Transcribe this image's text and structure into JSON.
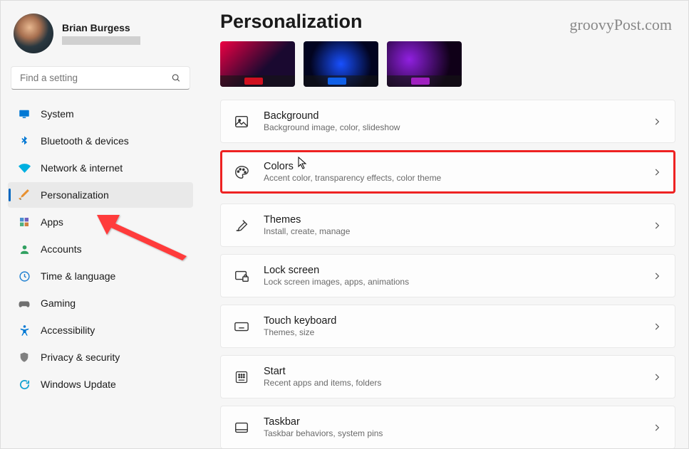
{
  "watermark": "groovyPost.com",
  "profile": {
    "name": "Brian Burgess"
  },
  "search": {
    "placeholder": "Find a setting"
  },
  "sidebar": {
    "items": [
      {
        "label": "System"
      },
      {
        "label": "Bluetooth & devices"
      },
      {
        "label": "Network & internet"
      },
      {
        "label": "Personalization"
      },
      {
        "label": "Apps"
      },
      {
        "label": "Accounts"
      },
      {
        "label": "Time & language"
      },
      {
        "label": "Gaming"
      },
      {
        "label": "Accessibility"
      },
      {
        "label": "Privacy & security"
      },
      {
        "label": "Windows Update"
      }
    ]
  },
  "page": {
    "title": "Personalization"
  },
  "themes": {
    "accents": [
      "#d01020",
      "#1060e8",
      "#a020c0"
    ]
  },
  "cards": [
    {
      "title": "Background",
      "sub": "Background image, color, slideshow"
    },
    {
      "title": "Colors",
      "sub": "Accent color, transparency effects, color theme"
    },
    {
      "title": "Themes",
      "sub": "Install, create, manage"
    },
    {
      "title": "Lock screen",
      "sub": "Lock screen images, apps, animations"
    },
    {
      "title": "Touch keyboard",
      "sub": "Themes, size"
    },
    {
      "title": "Start",
      "sub": "Recent apps and items, folders"
    },
    {
      "title": "Taskbar",
      "sub": "Taskbar behaviors, system pins"
    }
  ]
}
